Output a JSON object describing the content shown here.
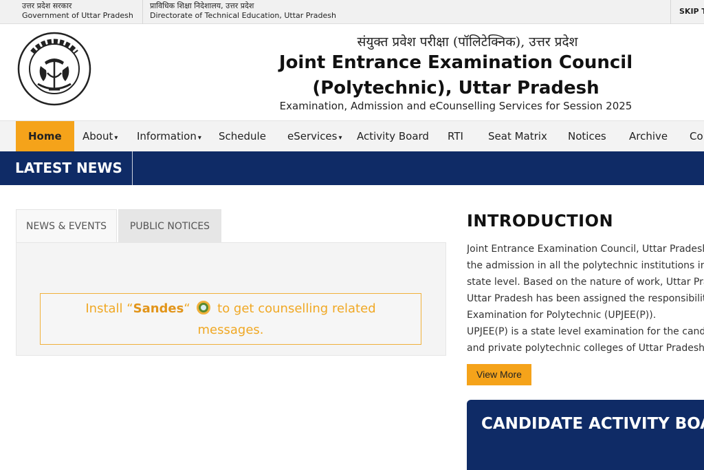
{
  "topbar": {
    "gov_hindi": "उत्तर प्रदेश सरकार",
    "gov_english": "Government of Uttar Pradesh",
    "dte_hindi": "प्राविधिक शिक्षा निदेशालय, उत्तर प्रदेश",
    "dte_english": "Directorate of Technical Education, Uttar Pradesh",
    "skip": "SKIP T"
  },
  "header": {
    "hindi_title": "संयुक्त प्रवेश परीक्षा (पॉलिटेक्निक), उत्तर प्रदेश",
    "title_line1": "Joint Entrance Examination Council",
    "title_line2": "(Polytechnic), Uttar Pradesh",
    "subtitle": "Examination, Admission and eCounselling Services for Session 2025",
    "emblem_icon": "up-government-emblem-icon"
  },
  "nav": {
    "items": [
      {
        "label": "Home",
        "active": true
      },
      {
        "label": "About",
        "dropdown": true
      },
      {
        "label": "Information",
        "dropdown": true
      },
      {
        "label": "Schedule"
      },
      {
        "label": "eServices",
        "dropdown": true
      },
      {
        "label": "Activity Board"
      },
      {
        "label": "RTI"
      },
      {
        "label": "Seat Matrix"
      },
      {
        "label": "Notices"
      },
      {
        "label": "Archive"
      },
      {
        "label": "Co"
      }
    ]
  },
  "latest_news": {
    "label": "LATEST NEWS"
  },
  "tabs": {
    "news_events": "NEWS & EVENTS",
    "public_notices": "PUBLIC NOTICES"
  },
  "notice": {
    "prefix": "Install “",
    "brand": "Sandes",
    "after_brand": "“",
    "suffix": "to get counselling related",
    "line2": "messages.",
    "icon": "sandes-app-icon"
  },
  "introduction": {
    "title": "INTRODUCTION",
    "lines": [
      "Joint Entrance Examination Council, Uttar Pradesh (JE",
      "the admission in all the polytechnic institutions in the",
      "state level. Based on the nature of work, Uttar Pra",
      "Uttar Pradesh has been assigned the responsibility to",
      "Examination for Polytechnic (UPJEE(P)).",
      "UPJEE(P) is a state level examination for the candida",
      "and private polytechnic colleges of Uttar Pradesh."
    ],
    "view_more": "View More"
  },
  "activity_board": {
    "title": "CANDIDATE ACTIVITY BOARD"
  },
  "colors": {
    "navy": "#0f2b66",
    "saffron": "#f5a31a",
    "notice_text": "#f0a824"
  }
}
